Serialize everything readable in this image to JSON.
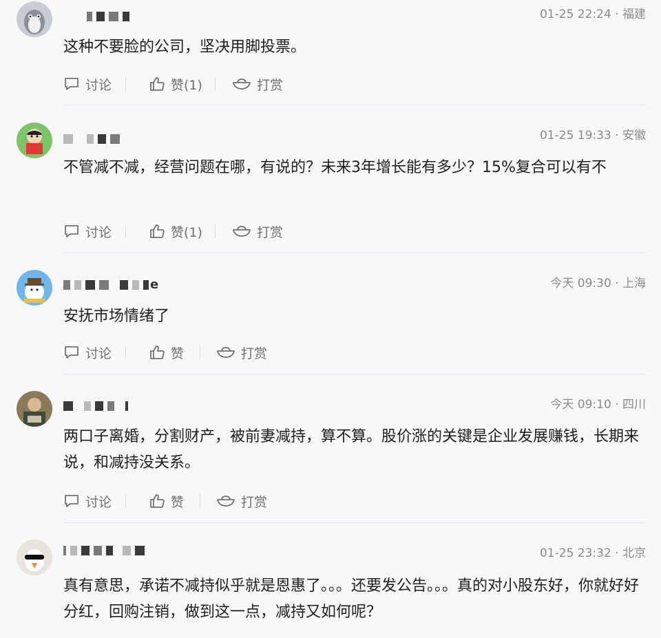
{
  "actions": {
    "discuss": "讨论",
    "tip": "打赏"
  },
  "comments": [
    {
      "time": "01-25 22:24 · 福建",
      "text": "这种不要脸的公司，坚决用脚投票。",
      "like": "赞(1)"
    },
    {
      "time": "01-25 19:33 · 安徽",
      "text": "不管减不减，经营问题在哪，有说的？未来3年增长能有多少？15%复合可以有不",
      "like": "赞(1)"
    },
    {
      "time": "今天 09:30 · 上海",
      "text": "安抚市场情绪了",
      "like": "赞",
      "name_tail": "e"
    },
    {
      "time": "今天 09:10 · 四川",
      "text": "两口子离婚，分割财产，被前妻减持，算不算。股价涨的关键是企业发展赚钱，长期来说，和减持没关系。",
      "like": "赞"
    },
    {
      "time": "01-25 23:32 · 北京",
      "text": "真有意思，承诺不减持似乎就是恩惠了。。。还要发公告。。。真的对小股东好，你就好好分红，回购注销，做到这一点，减持又如何呢？",
      "like": null
    }
  ]
}
